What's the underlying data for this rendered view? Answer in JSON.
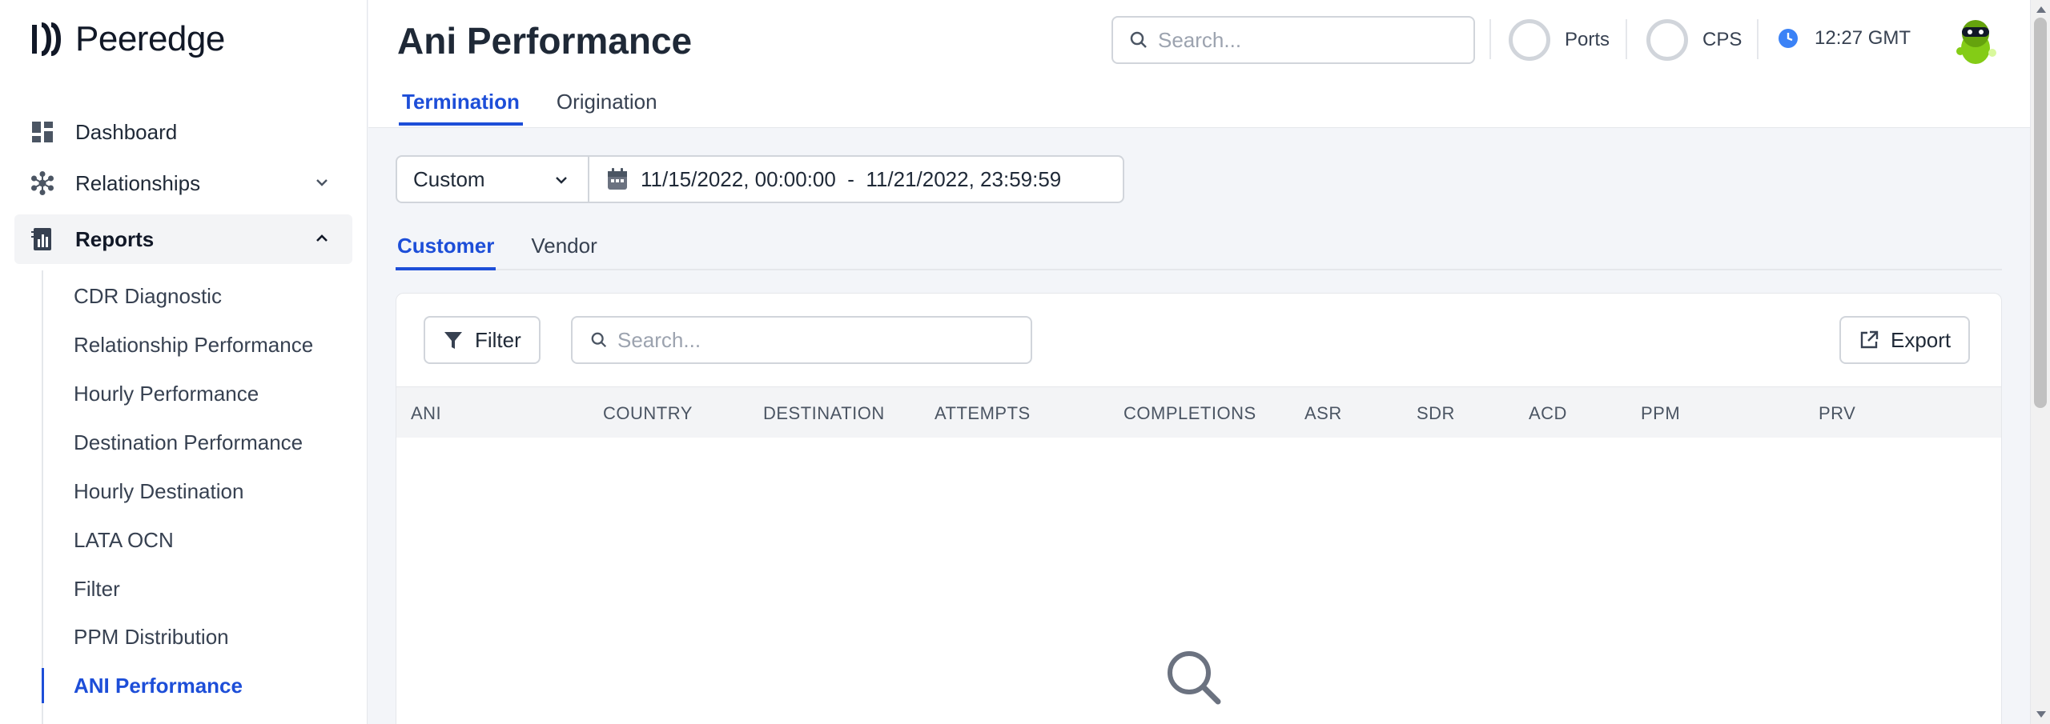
{
  "app": {
    "name": "Peeredge"
  },
  "sidebar": {
    "nav": [
      {
        "label": "Dashboard",
        "icon": "dashboard-icon"
      },
      {
        "label": "Relationships",
        "icon": "relationships-icon"
      },
      {
        "label": "Reports",
        "icon": "reports-icon"
      }
    ],
    "report_items": [
      {
        "label": "CDR Diagnostic"
      },
      {
        "label": "Relationship Performance"
      },
      {
        "label": "Hourly Performance"
      },
      {
        "label": "Destination Performance"
      },
      {
        "label": "Hourly Destination"
      },
      {
        "label": "LATA OCN"
      },
      {
        "label": "Filter"
      },
      {
        "label": "PPM Distribution"
      },
      {
        "label": "ANI Performance"
      }
    ],
    "active_item": "ANI Performance"
  },
  "header": {
    "title": "Ani Performance",
    "search_placeholder": "Search...",
    "ports_label": "Ports",
    "cps_label": "CPS",
    "time": "12:27 GMT",
    "tabs": [
      {
        "label": "Termination"
      },
      {
        "label": "Origination"
      }
    ],
    "active_tab": "Termination"
  },
  "range": {
    "selected": "Custom",
    "dates": "11/15/2022, 00:00:00  -  11/21/2022, 23:59:59"
  },
  "sub_tabs": [
    {
      "label": "Customer"
    },
    {
      "label": "Vendor"
    }
  ],
  "active_sub_tab": "Customer",
  "table": {
    "filter_label": "Filter",
    "search_placeholder": "Search...",
    "export_label": "Export",
    "columns": [
      "ANI",
      "COUNTRY",
      "DESTINATION",
      "ATTEMPTS",
      "COMPLETIONS",
      "ASR",
      "SDR",
      "ACD",
      "PPM",
      "PRV"
    ],
    "rows": []
  },
  "colors": {
    "accent": "#1d4ed8",
    "clock": "#3b82f6",
    "background": "#f3f5f9"
  }
}
